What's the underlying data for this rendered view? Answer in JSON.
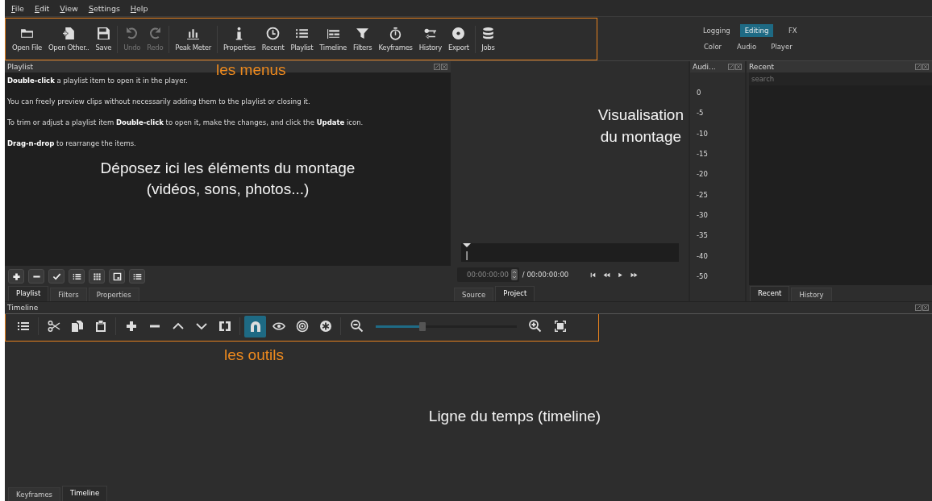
{
  "menu_bar": [
    "File",
    "Edit",
    "View",
    "Settings",
    "Help"
  ],
  "toolbar": [
    {
      "label": "Open File",
      "disabled": false
    },
    {
      "label": "Open Other..",
      "disabled": false
    },
    {
      "label": "Save",
      "disabled": false
    },
    {
      "label": "Undo",
      "disabled": true
    },
    {
      "label": "Redo",
      "disabled": true
    },
    {
      "label": "Peak Meter",
      "disabled": false
    },
    {
      "label": "Properties",
      "disabled": false
    },
    {
      "label": "Recent",
      "disabled": false
    },
    {
      "label": "Playlist",
      "disabled": false
    },
    {
      "label": "Timeline",
      "disabled": false
    },
    {
      "label": "Filters",
      "disabled": false
    },
    {
      "label": "Keyframes",
      "disabled": false
    },
    {
      "label": "History",
      "disabled": false
    },
    {
      "label": "Export",
      "disabled": false
    },
    {
      "label": "Jobs",
      "disabled": false
    }
  ],
  "layouts": [
    [
      {
        "label": "Logging",
        "selected": false
      },
      {
        "label": "Editing",
        "selected": true
      },
      {
        "label": "FX",
        "selected": false
      }
    ],
    [
      {
        "label": "Color",
        "selected": false
      },
      {
        "label": "Audio",
        "selected": false
      },
      {
        "label": "Player",
        "selected": false
      }
    ]
  ],
  "toolbar_annotation": "les menus",
  "playlist": {
    "title": "Playlist",
    "paragraphs": [
      "**Double-click** a playlist item to open it in the player.",
      "You can freely preview clips without necessarily adding them to the playlist or closing it.",
      "To trim or adjust a playlist item **Double-click** to open it, make the changes, and click the **Update** icon.",
      "**Drag-n-drop** to rearrange the items."
    ],
    "annotation": "Déposez ici les éléments du montage\n(vidéos, sons, photos...)",
    "tabs": [
      {
        "label": "Playlist",
        "selected": true
      },
      {
        "label": "Filters",
        "selected": false
      },
      {
        "label": "Properties",
        "selected": false
      }
    ]
  },
  "player": {
    "annotation": "Visualisation\ndu montage",
    "timecode": "00:00:00:00",
    "duration": "/ 00:00:00:00",
    "tabs": [
      {
        "label": "Source",
        "selected": false
      },
      {
        "label": "Project",
        "selected": true
      }
    ]
  },
  "audio_meter": {
    "title": "Audi...",
    "scale": [
      "0",
      "-5",
      "-10",
      "-15",
      "-20",
      "-25",
      "-30",
      "-35",
      "-40",
      "-50"
    ]
  },
  "recent": {
    "title": "Recent",
    "placeholder": "search",
    "tabs": [
      {
        "label": "Recent",
        "selected": true
      },
      {
        "label": "History",
        "selected": false
      }
    ]
  },
  "timeline": {
    "title": "Timeline",
    "tools": [
      {
        "selected": false
      },
      {
        "selected": false
      },
      {
        "selected": false
      },
      {
        "selected": false
      },
      {
        "selected": false
      },
      {
        "selected": false
      },
      {
        "selected": false
      },
      {
        "selected": false
      },
      {
        "selected": false
      },
      {
        "selected": true
      },
      {
        "selected": false
      },
      {
        "selected": false
      },
      {
        "selected": false
      }
    ],
    "zoom": {
      "level": 0.33
    },
    "tools_annotation": "les outils",
    "annotation": "Ligne du temps (timeline)",
    "tabs": [
      {
        "label": "Keyframes",
        "selected": false
      },
      {
        "label": "Timeline",
        "selected": true
      }
    ]
  }
}
